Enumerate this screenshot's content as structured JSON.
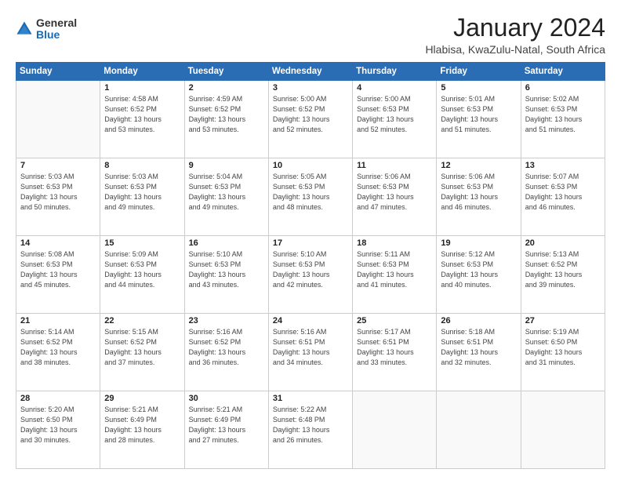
{
  "header": {
    "logo_general": "General",
    "logo_blue": "Blue",
    "month": "January 2024",
    "location": "Hlabisa, KwaZulu-Natal, South Africa"
  },
  "days_of_week": [
    "Sunday",
    "Monday",
    "Tuesday",
    "Wednesday",
    "Thursday",
    "Friday",
    "Saturday"
  ],
  "weeks": [
    [
      {
        "day": "",
        "info": ""
      },
      {
        "day": "1",
        "info": "Sunrise: 4:58 AM\nSunset: 6:52 PM\nDaylight: 13 hours\nand 53 minutes."
      },
      {
        "day": "2",
        "info": "Sunrise: 4:59 AM\nSunset: 6:52 PM\nDaylight: 13 hours\nand 53 minutes."
      },
      {
        "day": "3",
        "info": "Sunrise: 5:00 AM\nSunset: 6:52 PM\nDaylight: 13 hours\nand 52 minutes."
      },
      {
        "day": "4",
        "info": "Sunrise: 5:00 AM\nSunset: 6:53 PM\nDaylight: 13 hours\nand 52 minutes."
      },
      {
        "day": "5",
        "info": "Sunrise: 5:01 AM\nSunset: 6:53 PM\nDaylight: 13 hours\nand 51 minutes."
      },
      {
        "day": "6",
        "info": "Sunrise: 5:02 AM\nSunset: 6:53 PM\nDaylight: 13 hours\nand 51 minutes."
      }
    ],
    [
      {
        "day": "7",
        "info": "Sunrise: 5:03 AM\nSunset: 6:53 PM\nDaylight: 13 hours\nand 50 minutes."
      },
      {
        "day": "8",
        "info": "Sunrise: 5:03 AM\nSunset: 6:53 PM\nDaylight: 13 hours\nand 49 minutes."
      },
      {
        "day": "9",
        "info": "Sunrise: 5:04 AM\nSunset: 6:53 PM\nDaylight: 13 hours\nand 49 minutes."
      },
      {
        "day": "10",
        "info": "Sunrise: 5:05 AM\nSunset: 6:53 PM\nDaylight: 13 hours\nand 48 minutes."
      },
      {
        "day": "11",
        "info": "Sunrise: 5:06 AM\nSunset: 6:53 PM\nDaylight: 13 hours\nand 47 minutes."
      },
      {
        "day": "12",
        "info": "Sunrise: 5:06 AM\nSunset: 6:53 PM\nDaylight: 13 hours\nand 46 minutes."
      },
      {
        "day": "13",
        "info": "Sunrise: 5:07 AM\nSunset: 6:53 PM\nDaylight: 13 hours\nand 46 minutes."
      }
    ],
    [
      {
        "day": "14",
        "info": "Sunrise: 5:08 AM\nSunset: 6:53 PM\nDaylight: 13 hours\nand 45 minutes."
      },
      {
        "day": "15",
        "info": "Sunrise: 5:09 AM\nSunset: 6:53 PM\nDaylight: 13 hours\nand 44 minutes."
      },
      {
        "day": "16",
        "info": "Sunrise: 5:10 AM\nSunset: 6:53 PM\nDaylight: 13 hours\nand 43 minutes."
      },
      {
        "day": "17",
        "info": "Sunrise: 5:10 AM\nSunset: 6:53 PM\nDaylight: 13 hours\nand 42 minutes."
      },
      {
        "day": "18",
        "info": "Sunrise: 5:11 AM\nSunset: 6:53 PM\nDaylight: 13 hours\nand 41 minutes."
      },
      {
        "day": "19",
        "info": "Sunrise: 5:12 AM\nSunset: 6:53 PM\nDaylight: 13 hours\nand 40 minutes."
      },
      {
        "day": "20",
        "info": "Sunrise: 5:13 AM\nSunset: 6:52 PM\nDaylight: 13 hours\nand 39 minutes."
      }
    ],
    [
      {
        "day": "21",
        "info": "Sunrise: 5:14 AM\nSunset: 6:52 PM\nDaylight: 13 hours\nand 38 minutes."
      },
      {
        "day": "22",
        "info": "Sunrise: 5:15 AM\nSunset: 6:52 PM\nDaylight: 13 hours\nand 37 minutes."
      },
      {
        "day": "23",
        "info": "Sunrise: 5:16 AM\nSunset: 6:52 PM\nDaylight: 13 hours\nand 36 minutes."
      },
      {
        "day": "24",
        "info": "Sunrise: 5:16 AM\nSunset: 6:51 PM\nDaylight: 13 hours\nand 34 minutes."
      },
      {
        "day": "25",
        "info": "Sunrise: 5:17 AM\nSunset: 6:51 PM\nDaylight: 13 hours\nand 33 minutes."
      },
      {
        "day": "26",
        "info": "Sunrise: 5:18 AM\nSunset: 6:51 PM\nDaylight: 13 hours\nand 32 minutes."
      },
      {
        "day": "27",
        "info": "Sunrise: 5:19 AM\nSunset: 6:50 PM\nDaylight: 13 hours\nand 31 minutes."
      }
    ],
    [
      {
        "day": "28",
        "info": "Sunrise: 5:20 AM\nSunset: 6:50 PM\nDaylight: 13 hours\nand 30 minutes."
      },
      {
        "day": "29",
        "info": "Sunrise: 5:21 AM\nSunset: 6:49 PM\nDaylight: 13 hours\nand 28 minutes."
      },
      {
        "day": "30",
        "info": "Sunrise: 5:21 AM\nSunset: 6:49 PM\nDaylight: 13 hours\nand 27 minutes."
      },
      {
        "day": "31",
        "info": "Sunrise: 5:22 AM\nSunset: 6:48 PM\nDaylight: 13 hours\nand 26 minutes."
      },
      {
        "day": "",
        "info": ""
      },
      {
        "day": "",
        "info": ""
      },
      {
        "day": "",
        "info": ""
      }
    ]
  ]
}
